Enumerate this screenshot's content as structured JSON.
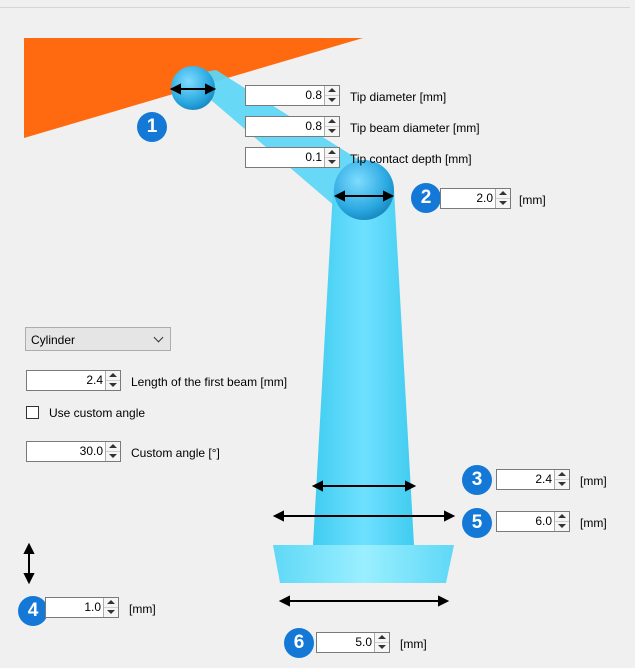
{
  "tip": {
    "diameter": {
      "value": "0.8",
      "label": "Tip diameter [mm]"
    },
    "beam_diameter": {
      "value": "0.8",
      "label": "Tip beam diameter [mm]"
    },
    "contact_depth": {
      "value": "0.1",
      "label": "Tip contact depth [mm]"
    }
  },
  "markers": [
    "1",
    "2",
    "3",
    "4",
    "5",
    "6"
  ],
  "joint": {
    "value": "2.0",
    "unit": "[mm]"
  },
  "beam": {
    "shape": "Cylinder",
    "length": {
      "value": "2.4",
      "label": "Length of the first beam [mm]"
    },
    "use_custom_angle": {
      "label": "Use custom angle",
      "checked": false
    },
    "custom_angle": {
      "value": "30.0",
      "label": "Custom angle [°]"
    }
  },
  "beam_bottom_width": {
    "value": "2.4",
    "unit": "[mm]"
  },
  "base_top_width": {
    "value": "6.0",
    "unit": "[mm]"
  },
  "base_height": {
    "value": "1.0",
    "unit": "[mm]"
  },
  "base_bottom_width": {
    "value": "5.0",
    "unit": "[mm]"
  },
  "colors": {
    "part": "#ff6a10",
    "beam": "#5fd6f5",
    "badge": "#1479d6"
  },
  "icons": [
    "double-arrow-icon",
    "spin-up-icon",
    "spin-down-icon",
    "chevron-down-icon"
  ]
}
